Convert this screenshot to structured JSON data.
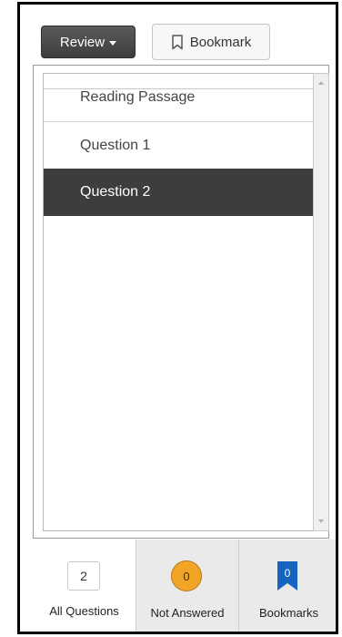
{
  "toolbar": {
    "review_label": "Review",
    "bookmark_label": "Bookmark"
  },
  "question_list": {
    "items": [
      {
        "label": "Reading Passage",
        "selected": false
      },
      {
        "label": "Question 1",
        "selected": false
      },
      {
        "label": "Question 2",
        "selected": true
      }
    ]
  },
  "tabs": [
    {
      "label": "All Questions",
      "count": "2",
      "active": true
    },
    {
      "label": "Not Answered",
      "count": "0",
      "active": false
    },
    {
      "label": "Bookmarks",
      "count": "0",
      "active": false
    }
  ],
  "colors": {
    "selected_bg": "#3d3d3d",
    "not_answered_badge": "#f2a427",
    "bookmark_badge": "#1565c0",
    "active_tab_underline": "#4a7fb5"
  }
}
